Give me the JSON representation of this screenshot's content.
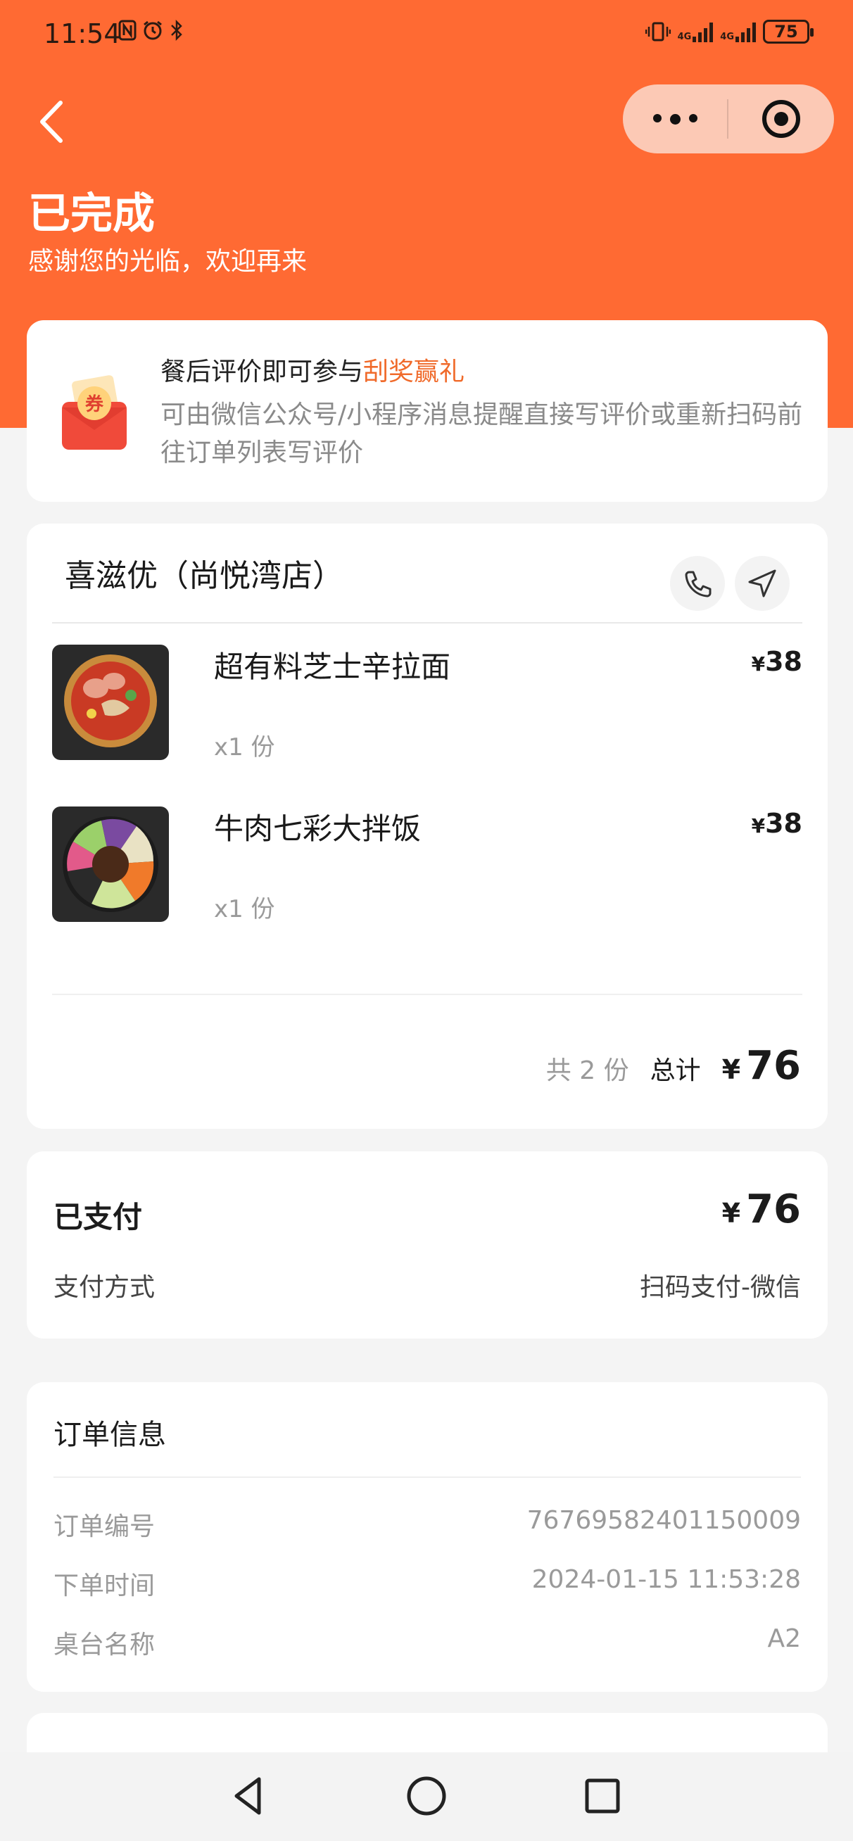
{
  "status_bar": {
    "time": "11:54",
    "left_icons": [
      "nfc-icon",
      "alarm-icon",
      "bluetooth-icon"
    ],
    "right_icons": [
      "vibrate-icon",
      "signal-4g-icon",
      "signal-4g-icon"
    ],
    "network_label_1": "4G",
    "network_label_2": "4G",
    "battery": "75"
  },
  "header": {
    "title": "已完成",
    "subtitle": "感谢您的光临，欢迎再来",
    "background_color": "#ff6a33"
  },
  "promo": {
    "title_prefix": "餐后评价即可参与",
    "title_highlight": "刮奖赢礼",
    "description": "可由微信公众号/小程序消息提醒直接写评价或重新扫码前往订单列表写评价",
    "icon_text": "券",
    "highlight_color": "#f06a2a"
  },
  "store": {
    "name": "喜滋优（尚悦湾店）",
    "items": [
      {
        "name": "超有料芝士辛拉面",
        "currency": "¥",
        "price": "38",
        "qty": "x1 份"
      },
      {
        "name": "牛肉七彩大拌饭",
        "currency": "¥",
        "price": "38",
        "qty": "x1 份"
      }
    ],
    "count_text": "共 2 份",
    "total_label": "总计",
    "total_currency": "¥",
    "total": "76"
  },
  "payment": {
    "status": "已支付",
    "currency": "¥",
    "amount": "76",
    "method_label": "支付方式",
    "method": "扫码支付-微信"
  },
  "order_info": {
    "title": "订单信息",
    "rows": [
      {
        "label": "订单编号",
        "value": "76769582401150009"
      },
      {
        "label": "下单时间",
        "value": "2024-01-15 11:53:28"
      },
      {
        "label": "桌台名称",
        "value": "A2"
      }
    ]
  }
}
